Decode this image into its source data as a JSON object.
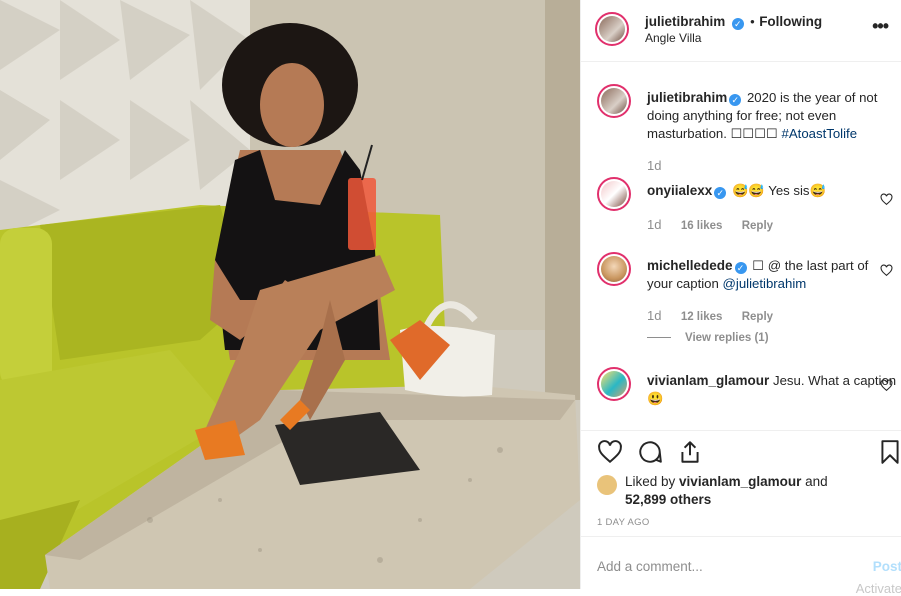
{
  "post": {
    "author": "julietibrahim",
    "follow_status": "Following",
    "separator": "•",
    "location": "Angle Villa",
    "more_icon": "•••"
  },
  "caption": {
    "author": "julietibrahim",
    "text": "2020 is the year of not doing anything for free; not even masturbation. ",
    "emoji": "☐☐☐☐",
    "hashtag": "#AtoastTolife",
    "time": "1d"
  },
  "comments": [
    {
      "author": "onyiialexx",
      "text": "😅😅 Yes sis😅",
      "time": "1d",
      "likes": "16 likes",
      "reply": "Reply"
    },
    {
      "author": "michelledede",
      "text_before": "☐ @ the last part of your caption ",
      "mention": "@julietibrahim",
      "time": "1d",
      "likes": "12 likes",
      "reply": "Reply",
      "view_replies": "View replies (1)"
    },
    {
      "author": "vivianlam_glamour",
      "text": "Jesu. What a caption 😃"
    }
  ],
  "likes": {
    "prefix": "Liked by ",
    "user": "vivianlam_glamour",
    "middle": " and",
    "count": "52,899 others"
  },
  "timestamp": "1 DAY AGO",
  "add_comment": {
    "placeholder": "Add a comment...",
    "post_label": "Post"
  },
  "watermark": "Activate",
  "colors": {
    "accent": "#3897f0",
    "link": "#00376b",
    "muted": "#8e8e8e",
    "ring": "#e1306c"
  }
}
